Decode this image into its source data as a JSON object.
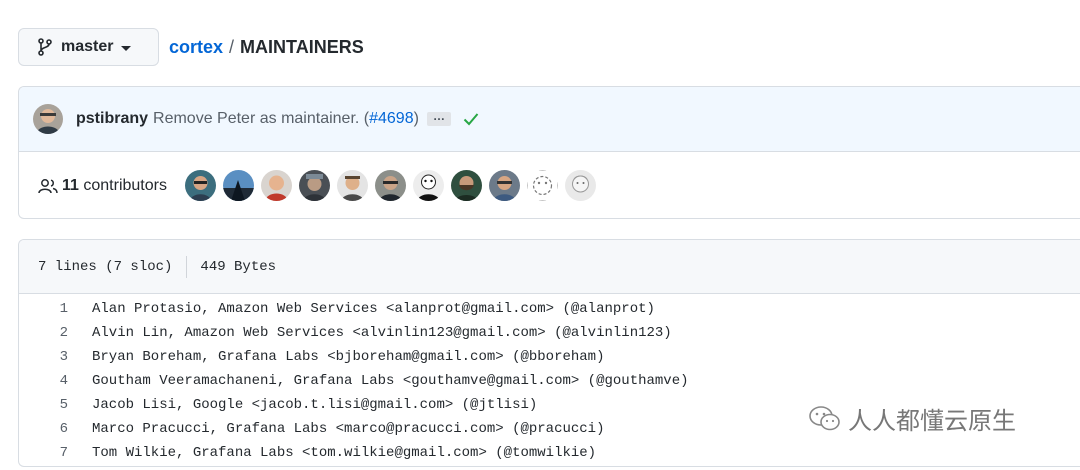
{
  "branch": {
    "name": "master"
  },
  "breadcrumb": {
    "repo": "cortex",
    "separator": "/",
    "file": "MAINTAINERS"
  },
  "commit": {
    "author": "pstibrany",
    "message_before": "Remove Peter as maintainer. (",
    "pr_link": "#4698",
    "message_after": ")",
    "ellipsis": "…",
    "status_icon": "check-icon",
    "status_color": "#28a745"
  },
  "contributors": {
    "count": "11",
    "label": "contributors",
    "avatar_count": 11
  },
  "file": {
    "lines_info": "7 lines (7 sloc)",
    "size": "449 Bytes",
    "lines": [
      {
        "number": "1",
        "text": "Alan Protasio, Amazon Web Services <alanprot@gmail.com> (@alanprot)"
      },
      {
        "number": "2",
        "text": "Alvin Lin, Amazon Web Services <alvinlin123@gmail.com> (@alvinlin123)"
      },
      {
        "number": "3",
        "text": "Bryan Boreham, Grafana Labs <bjboreham@gmail.com> (@bboreham)"
      },
      {
        "number": "4",
        "text": "Goutham Veeramachaneni, Grafana Labs <gouthamve@gmail.com> (@gouthamve)"
      },
      {
        "number": "5",
        "text": "Jacob Lisi, Google <jacob.t.lisi@gmail.com> (@jtlisi)"
      },
      {
        "number": "6",
        "text": "Marco Pracucci, Grafana Labs <marco@pracucci.com> (@pracucci)"
      },
      {
        "number": "7",
        "text": "Tom Wilkie, Grafana Labs <tom.wilkie@gmail.com> (@tomwilkie)"
      }
    ]
  },
  "watermark": {
    "text": "人人都懂云原生"
  },
  "colors": {
    "link": "#0366d6",
    "success": "#28a745",
    "text": "#24292e",
    "muted": "#586069"
  }
}
